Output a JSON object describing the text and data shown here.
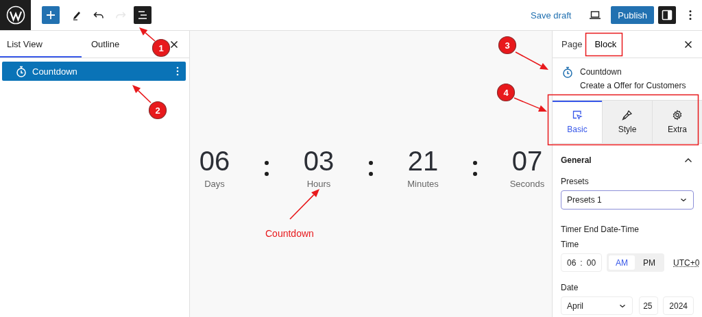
{
  "topbar": {
    "tools": [
      {
        "kind": "add",
        "pressed": false,
        "disabled": false
      },
      {
        "kind": "edit",
        "pressed": false,
        "disabled": false
      },
      {
        "kind": "undo",
        "pressed": false,
        "disabled": false
      },
      {
        "kind": "redo",
        "pressed": false,
        "disabled": true
      },
      {
        "kind": "listview",
        "pressed": true,
        "disabled": false
      }
    ],
    "save_draft": "Save draft",
    "publish": "Publish",
    "settings_pressed": true
  },
  "list_panel": {
    "tabs": [
      {
        "label": "List View",
        "selected": true
      },
      {
        "label": "Outline",
        "selected": false
      }
    ],
    "items": [
      {
        "label": "Countdown",
        "selected": true
      }
    ]
  },
  "canvas": {
    "units": [
      {
        "value": "06",
        "label": "Days"
      },
      {
        "value": "03",
        "label": "Hours"
      },
      {
        "value": "21",
        "label": "Minutes"
      },
      {
        "value": "07",
        "label": "Seconds"
      }
    ]
  },
  "sidebar": {
    "tabs": [
      {
        "label": "Page",
        "selected": false
      },
      {
        "label": "Block",
        "selected": true
      }
    ],
    "block": {
      "title": "Countdown",
      "description": "Create a Offer for Customers"
    },
    "panel_tabs": [
      {
        "kind": "basic",
        "label": "Basic",
        "selected": true
      },
      {
        "kind": "style",
        "label": "Style",
        "selected": false
      },
      {
        "kind": "extra",
        "label": "Extra",
        "selected": false
      }
    ],
    "section": {
      "title": "General",
      "expanded": true
    },
    "presets": {
      "label": "Presets",
      "value": "Presets 1"
    },
    "timer_heading": "Timer End Date-Time",
    "time": {
      "label": "Time",
      "hour": "06",
      "separator": ":",
      "minute": "00",
      "periods": [
        {
          "label": "AM",
          "selected": true
        },
        {
          "label": "PM",
          "selected": false
        }
      ],
      "timezone": "UTC+0"
    },
    "date": {
      "label": "Date",
      "month": "April",
      "day": "25",
      "year": "2024"
    }
  },
  "annotations": {
    "markers": [
      {
        "label": "1"
      },
      {
        "label": "2"
      },
      {
        "label": "3"
      },
      {
        "label": "4"
      }
    ],
    "caption": "Countdown"
  }
}
